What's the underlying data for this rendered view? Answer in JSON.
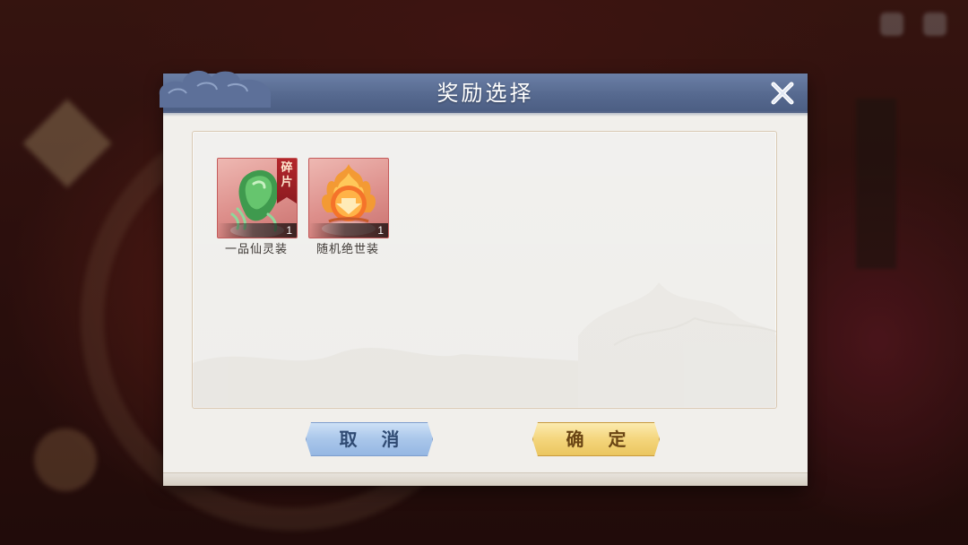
{
  "dialog": {
    "title": "奖励选择",
    "cancel_label": "取 消",
    "confirm_label": "确 定"
  },
  "rewards": [
    {
      "name": "一品仙灵装",
      "quantity": "1",
      "tag": "碎片",
      "icon": "green-jade-fragment-icon"
    },
    {
      "name": "随机绝世装",
      "quantity": "1",
      "icon": "flaming-orb-icon"
    }
  ],
  "colors": {
    "header": "#56698f",
    "item_frame": "#dd8f8b",
    "cancel_button": "#a9c6ea",
    "confirm_button": "#f4d57c"
  }
}
